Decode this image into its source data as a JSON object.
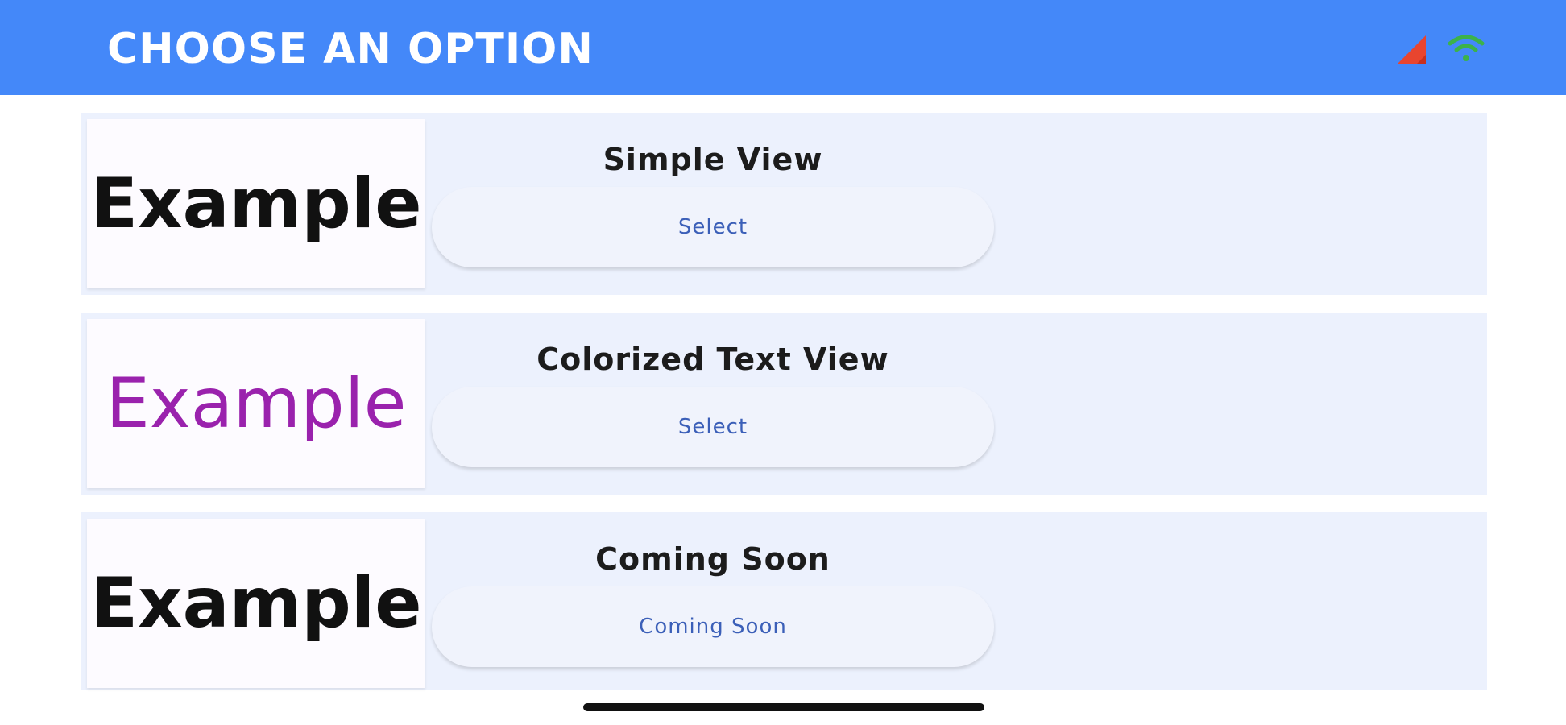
{
  "app_bar": {
    "title": "CHOOSE AN OPTION",
    "background": "#4488f9",
    "status_icons": [
      "cell-signal-icon",
      "wifi-icon"
    ]
  },
  "options": [
    {
      "thumbnail_text": "Example",
      "thumbnail_color": "#111111",
      "title": "Simple View",
      "button_label": "Select"
    },
    {
      "thumbnail_text": "Example",
      "thumbnail_color": "#9a22ad",
      "title": "Colorized Text View",
      "button_label": "Select"
    },
    {
      "thumbnail_text": "Example",
      "thumbnail_color": "#111111",
      "title": "Coming Soon",
      "button_label": "Coming Soon"
    }
  ],
  "colors": {
    "card_background": "#ecf1fd",
    "button_text": "#3b5fb8",
    "signal_icon": "#e8452f",
    "wifi_icon": "#3cb24a"
  }
}
